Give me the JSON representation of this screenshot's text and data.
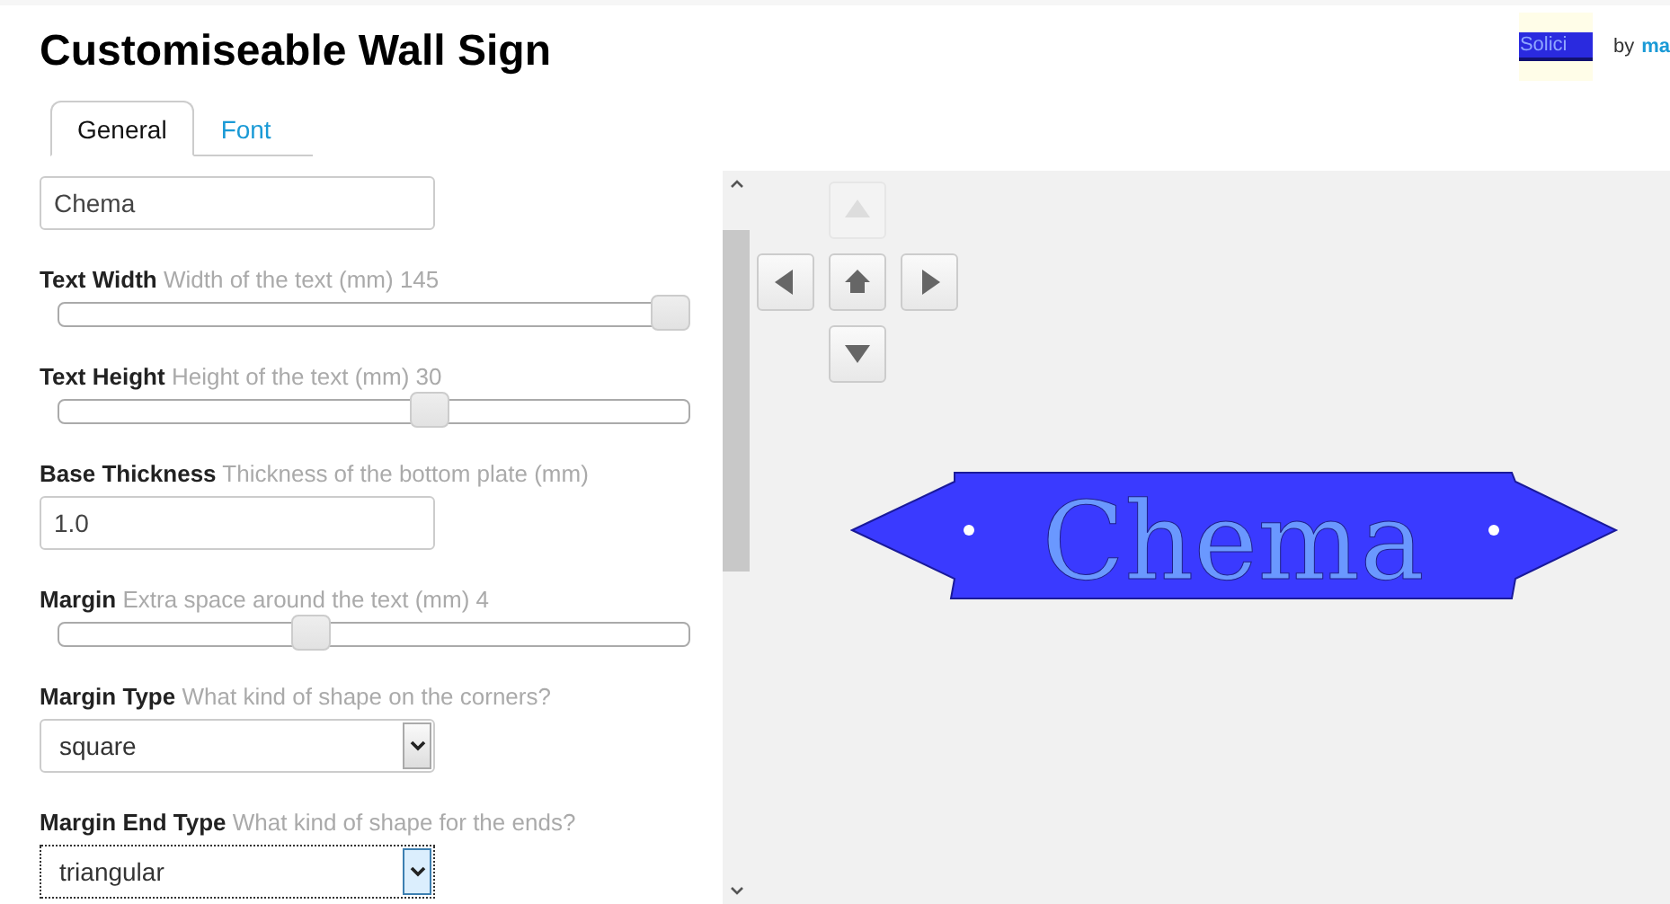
{
  "title": "Customiseable Wall Sign",
  "logo": {
    "text": "Solici"
  },
  "byline": {
    "prefix": "by",
    "author": "ma"
  },
  "tabs": [
    {
      "label": "General",
      "selected": true
    },
    {
      "label": "Font",
      "selected": false
    }
  ],
  "fields": [
    {
      "kind": "text",
      "value": "Chema"
    },
    {
      "kind": "slider",
      "label": "Text Width",
      "hint": "Width of the text (mm) 145",
      "level": 0.97
    },
    {
      "kind": "slider",
      "label": "Text Height",
      "hint": "Height of the text (mm) 30",
      "level": 0.59
    },
    {
      "kind": "text",
      "label": "Base Thickness",
      "hint": "Thickness of the bottom plate (mm)",
      "value": "1.0"
    },
    {
      "kind": "slider",
      "label": "Margin",
      "hint": "Extra space around the text (mm) 4",
      "level": 0.4
    },
    {
      "kind": "select",
      "label": "Margin Type",
      "hint": "What kind of shape on the corners?",
      "value": "square",
      "focused": false
    },
    {
      "kind": "select",
      "label": "Margin End Type",
      "hint": "What kind of shape for the ends?",
      "value": "triangular",
      "focused": true
    }
  ],
  "viewer": {
    "nav": [
      {
        "kind": "up",
        "disabled": true
      },
      {
        "kind": "left",
        "disabled": false
      },
      {
        "kind": "home",
        "disabled": false
      },
      {
        "kind": "right",
        "disabled": false
      },
      {
        "kind": "down",
        "disabled": false
      }
    ],
    "sign_text": "Chema"
  }
}
